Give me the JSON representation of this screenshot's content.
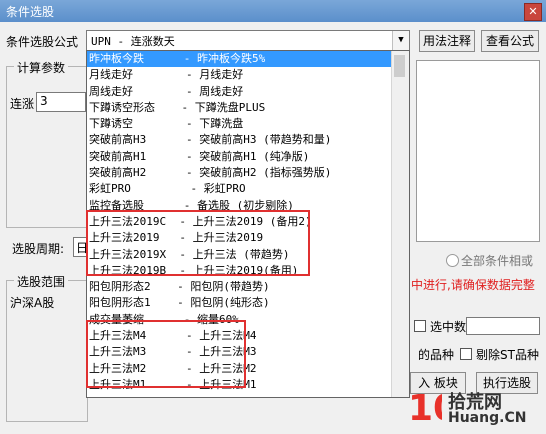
{
  "window": {
    "title": "条件选股",
    "close_glyph": "✕"
  },
  "formula": {
    "label": "条件选股公式",
    "selected": "UPN          - 连涨数天",
    "arrow": "▼",
    "usage_button": "用法注释",
    "view_button": "查看公式"
  },
  "calc_params": {
    "label": "计算参数",
    "param_label": "连涨",
    "param_value": "3"
  },
  "period": {
    "label": "选股周期:",
    "value": "日"
  },
  "scope": {
    "label": "选股范围",
    "value": "沪深A股"
  },
  "right_panel": {
    "all_conditions_label": "全部条件相或",
    "warning": "中进行,请确保数据完整",
    "select_count_label": "选中数",
    "products_label": "的品种",
    "exclude_st_label": "剔除ST品种",
    "import_button": "入 板块",
    "run_button": "执行选股"
  },
  "dropdown": {
    "items": [
      "昨冲板今跌      - 昨冲板今跌5%",
      "月线走好        - 月线走好",
      "周线走好        - 周线走好",
      "下蹲诱空形态    - 下蹲洗盘PLUS",
      "下蹲诱空        - 下蹲洗盘",
      "突破前高H3      - 突破前高H3 (带趋势和量)",
      "突破前高H1      - 突破前高H1 (纯净版)",
      "突破前高H2      - 突破前高H2 (指标强势版)",
      "彩虹PRO         - 彩虹PRO",
      "监控备选股      - 备选股 (初步剔除)",
      "上升三法2019C  - 上升三法2019 (备用2)",
      "上升三法2019   - 上升三法2019",
      "上升三法2019X  - 上升三法 (带趋势)",
      "上升三法2019B  - 上升三法2019(备用)",
      "阳包阴形态2    - 阳包阴(带趋势)",
      "阳包阴形态1    - 阳包阴(纯形态)",
      "成交量萎缩      - 缩量60%",
      "上升三法M4      - 上升三法M4",
      "上升三法M3      - 上升三法M3",
      "上升三法M2      - 上升三法M2",
      "上升三法M1      - 上升三法M1"
    ]
  },
  "watermark": {
    "site": "拾荒网",
    "domain": "Huang.CN",
    "number": "10"
  }
}
